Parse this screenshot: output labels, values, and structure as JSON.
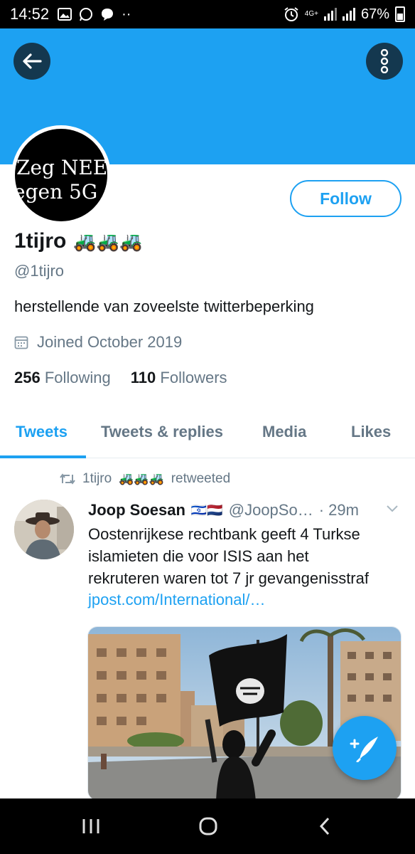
{
  "status_bar": {
    "time": "14:52",
    "dots": "··",
    "network": "4G+",
    "battery": "67%"
  },
  "profile": {
    "avatar_text_line1": "Zeg NEE",
    "avatar_text_line2": "egen 5G",
    "display_name": "1tijro",
    "name_emoji": "🚜🚜🚜",
    "handle": "@1tijro",
    "bio": "herstellende van zoveelste twitterbeperking",
    "joined": "Joined October 2019",
    "following_count": "256",
    "following_label": "Following",
    "followers_count": "110",
    "followers_label": "Followers",
    "follow_button": "Follow"
  },
  "tabs": [
    {
      "label": "Tweets",
      "active": true
    },
    {
      "label": "Tweets & replies",
      "active": false
    },
    {
      "label": "Media",
      "active": false
    },
    {
      "label": "Likes",
      "active": false
    }
  ],
  "tweet": {
    "retweeted_by": "1tijro",
    "retweeted_emoji": "🚜🚜🚜",
    "retweeted_label": "retweeted",
    "author_name": "Joop Soesan",
    "author_flags": "🇮🇱🇳🇱",
    "author_handle": "@JoopSo…",
    "time": "· 29m",
    "text_lines": [
      "Oostenrijkese rechtbank geeft 4 Turkse",
      "islamieten die voor ISIS aan het",
      "rekruteren waren tot 7 jr gevangenisstraf"
    ],
    "link": "jpost.com/International/…"
  },
  "colors": {
    "accent": "#1da1f2",
    "banner": "#1da1f2",
    "muted": "#657786"
  },
  "icons": {
    "back": "arrow-left-icon",
    "more": "more-vertical-icon",
    "calendar": "calendar-icon",
    "retweet": "retweet-icon",
    "compose": "compose-tweet-icon"
  }
}
